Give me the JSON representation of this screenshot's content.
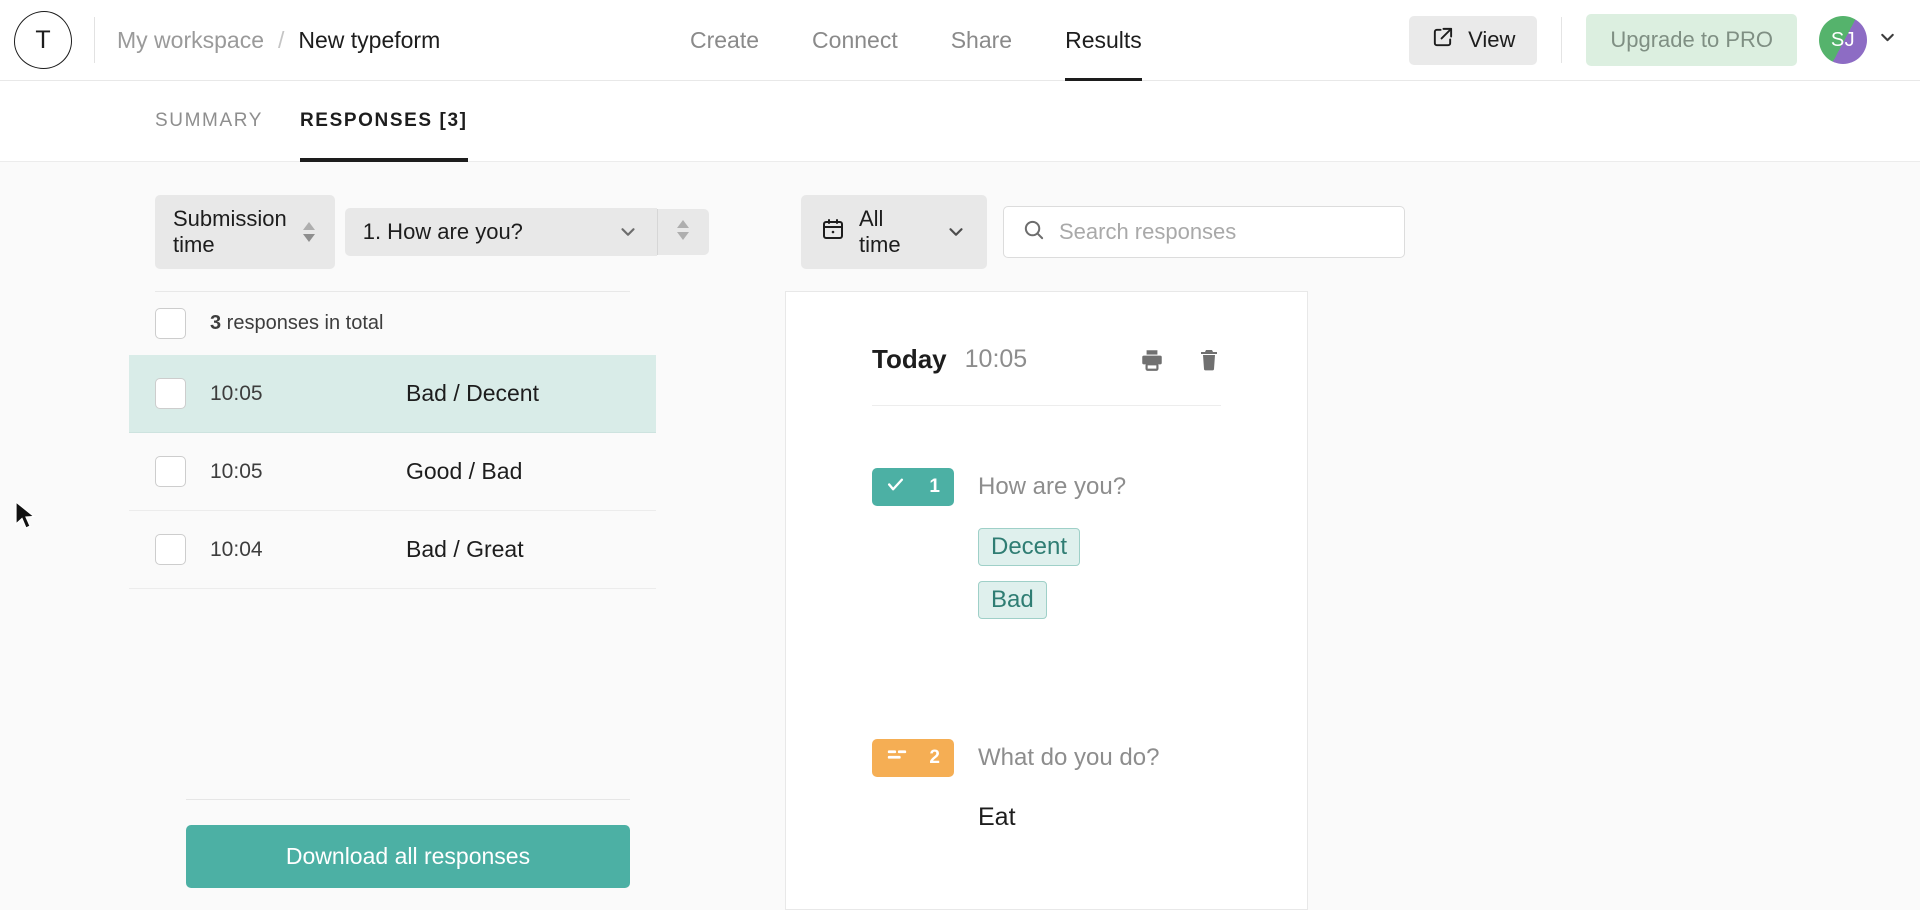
{
  "header": {
    "logo_letter": "T",
    "breadcrumb": {
      "workspace": "My workspace",
      "separator": "/",
      "current": "New typeform"
    },
    "nav": [
      {
        "label": "Create",
        "active": false
      },
      {
        "label": "Connect",
        "active": false
      },
      {
        "label": "Share",
        "active": false
      },
      {
        "label": "Results",
        "active": true
      }
    ],
    "view_button": "View",
    "upgrade_button": "Upgrade to PRO",
    "avatar_initials": "SJ"
  },
  "subtabs": [
    {
      "label": "SUMMARY",
      "active": false
    },
    {
      "label": "RESPONSES [3]",
      "active": true
    }
  ],
  "filters": {
    "sort_label": "Submission time",
    "question_label": "1. How are you?",
    "date_label": "All time",
    "search_placeholder": "Search responses",
    "search_value": ""
  },
  "list": {
    "total_label_count": "3",
    "total_label_text": " responses in total",
    "rows": [
      {
        "time": "10:05",
        "label": "Bad / Decent",
        "selected": true
      },
      {
        "time": "10:05",
        "label": "Good / Bad",
        "selected": false
      },
      {
        "time": "10:04",
        "label": "Bad / Great",
        "selected": false
      }
    ],
    "download_button": "Download all responses"
  },
  "detail": {
    "day_label": "Today",
    "time_label": "10:05",
    "questions": [
      {
        "number": "1",
        "type": "multiple-choice",
        "badge_color": "#4cb0a4",
        "title": "How are you?",
        "answer_chips": [
          "Decent",
          "Bad"
        ],
        "answer_text": ""
      },
      {
        "number": "2",
        "type": "short-text",
        "badge_color": "#f5ae54",
        "title": "What do you do?",
        "answer_chips": [],
        "answer_text": "Eat"
      }
    ]
  },
  "colors": {
    "teal": "#4cb0a4",
    "orange": "#f5ae54",
    "selected_row": "#d9ece8",
    "upgrade_bg": "#dcefe0"
  }
}
